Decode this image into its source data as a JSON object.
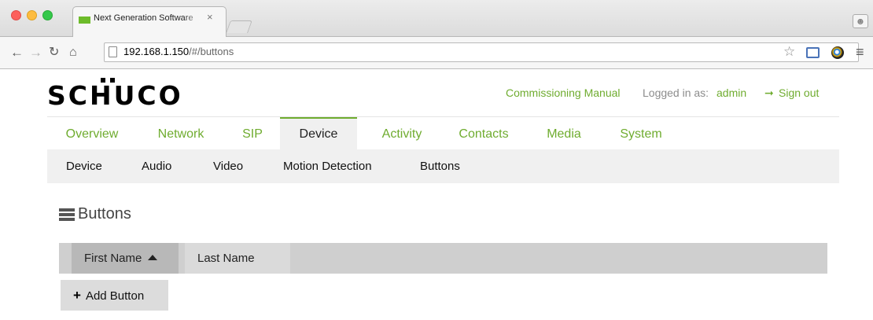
{
  "browser": {
    "tab_title": "Next Generation Software",
    "tab_close": "×",
    "url_host": "192.168.1.150",
    "url_path": "/#/buttons",
    "icons": [
      "back-arrow-icon",
      "forward-arrow-icon",
      "reload-icon",
      "home-icon",
      "page-icon",
      "bookmark-star-icon",
      "screenshot-extension-icon",
      "color-extension-icon",
      "menu-icon",
      "profile-icon"
    ]
  },
  "header": {
    "logo_text": "SCHUCO",
    "commissioning_manual": "Commissioning Manual",
    "logged_in_label": "Logged in as:",
    "username": "admin",
    "sign_out": "Sign out",
    "accent_color": "#6fac2f"
  },
  "main_nav": {
    "items": [
      "Overview",
      "Network",
      "SIP",
      "Device",
      "Activity",
      "Contacts",
      "Media",
      "System"
    ],
    "active": "Device"
  },
  "sub_nav": {
    "items": [
      "Device",
      "Audio",
      "Video",
      "Motion Detection",
      "Buttons"
    ]
  },
  "section": {
    "title": "Buttons"
  },
  "table": {
    "columns": [
      "First Name",
      "Last Name"
    ],
    "sorted_column": "First Name",
    "sort_direction": "ascending",
    "rows": []
  },
  "add_button_label": "Add Button"
}
